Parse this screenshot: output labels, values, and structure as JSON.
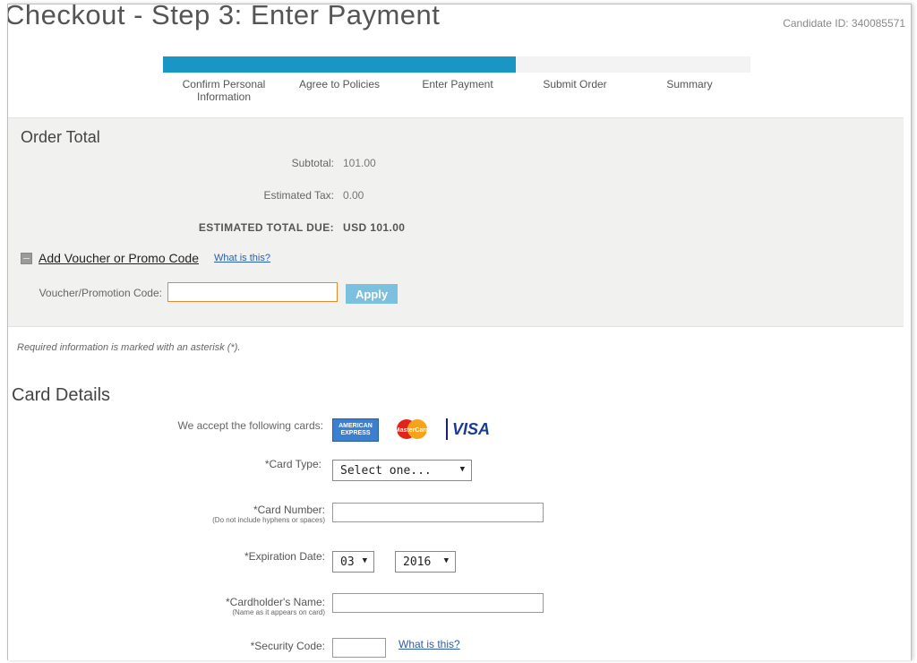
{
  "header": {
    "title": "Checkout - Step 3: Enter Payment",
    "candidate_id": "Candidate ID: 340085571"
  },
  "progress": {
    "fraction": 0.6,
    "steps": [
      {
        "label": "Confirm Personal",
        "label2": "Information"
      },
      {
        "label": "Agree to Policies",
        "label2": ""
      },
      {
        "label": "Enter Payment",
        "label2": ""
      },
      {
        "label": "Submit Order",
        "label2": ""
      },
      {
        "label": "Summary",
        "label2": ""
      }
    ],
    "active_color": "#1a96c4"
  },
  "order": {
    "heading": "Order Total",
    "subtotal_label": "Subtotal:",
    "subtotal_value": "101.00",
    "tax_label": "Estimated Tax:",
    "tax_value": "0.00",
    "total_label": "ESTIMATED TOTAL DUE:",
    "total_value": "USD 101.00"
  },
  "voucher": {
    "toggle_label": "Add Voucher or Promo Code",
    "what_link": "What is this?",
    "code_label": "Voucher/Promotion Code:",
    "code_value": "",
    "apply_label": "Apply"
  },
  "required_note": "Required information is marked with an asterisk (*).",
  "card_details": {
    "heading": "Card Details",
    "accept_label": "We accept the following cards:",
    "logos": [
      "AMERICAN EXPRESS",
      "MasterCard",
      "VISA"
    ],
    "card_type_label": "*Card Type:",
    "card_type_value": "Select one...",
    "card_number_label": "*Card Number:",
    "card_number_hint": "(Do not include hyphens or spaces)",
    "card_number_value": "",
    "exp_label": "*Expiration Date:",
    "exp_month": "03",
    "exp_year": "2016",
    "name_label": "*Cardholder's Name:",
    "name_hint": "(Name as it appears on card)",
    "name_value": "",
    "security_label": "*Security Code:",
    "security_value": "",
    "security_link": "What is this?"
  }
}
